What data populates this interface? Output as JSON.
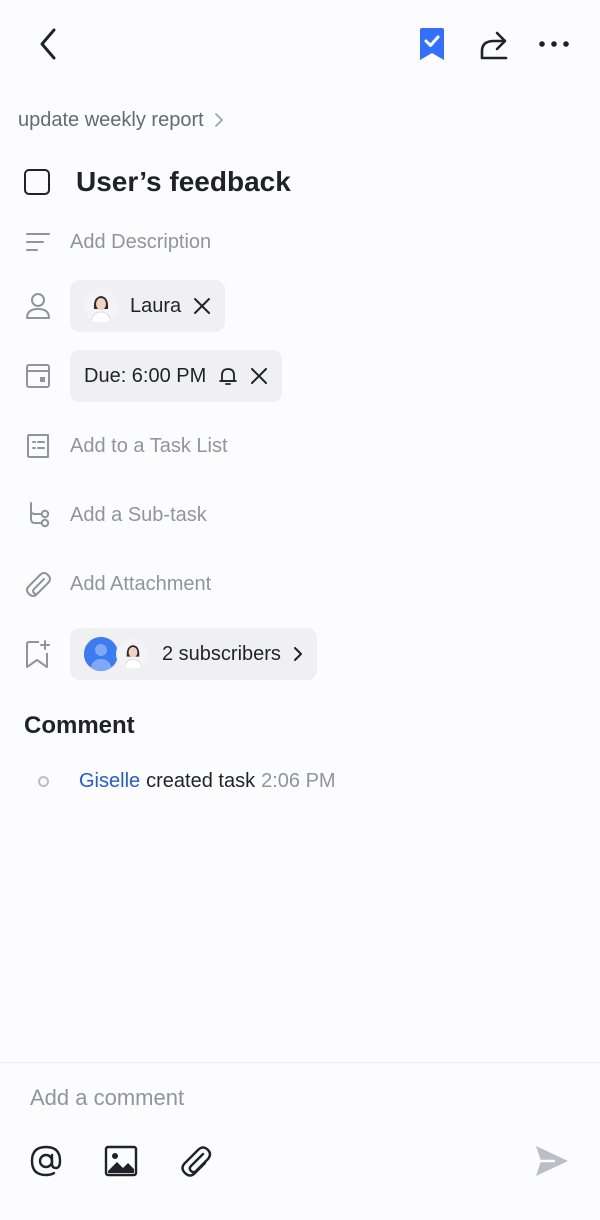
{
  "header": {
    "back_icon": "chevron-left-icon",
    "bookmark_icon": "bookmark-check-icon",
    "share_icon": "share-arrow-icon",
    "more_icon": "more-horizontal-icon",
    "accent": "#3370ff"
  },
  "breadcrumb": {
    "label": "update weekly report"
  },
  "task": {
    "title": "User’s feedback",
    "completed": false
  },
  "fields": {
    "description": {
      "placeholder": "Add Description",
      "icon": "description-lines-icon"
    },
    "assignee": {
      "name": "Laura",
      "icon": "person-icon"
    },
    "due": {
      "label": "Due: 6:00 PM",
      "icon": "calendar-icon"
    },
    "task_list": {
      "placeholder": "Add to a Task List",
      "icon": "task-list-icon"
    },
    "subtask": {
      "placeholder": "Add a Sub-task",
      "icon": "subtask-branch-icon"
    },
    "attachment": {
      "placeholder": "Add Attachment",
      "icon": "paperclip-icon"
    },
    "subscribers": {
      "label": "2 subscribers",
      "icon": "bookmark-plus-icon"
    }
  },
  "comments": {
    "section_title": "Comment",
    "activity": {
      "user": "Giselle",
      "action": "created task",
      "time": "2:06 PM"
    }
  },
  "composer": {
    "placeholder": "Add a comment",
    "tools": [
      "at-mention-icon",
      "image-icon",
      "paperclip-icon",
      "send-icon"
    ]
  }
}
